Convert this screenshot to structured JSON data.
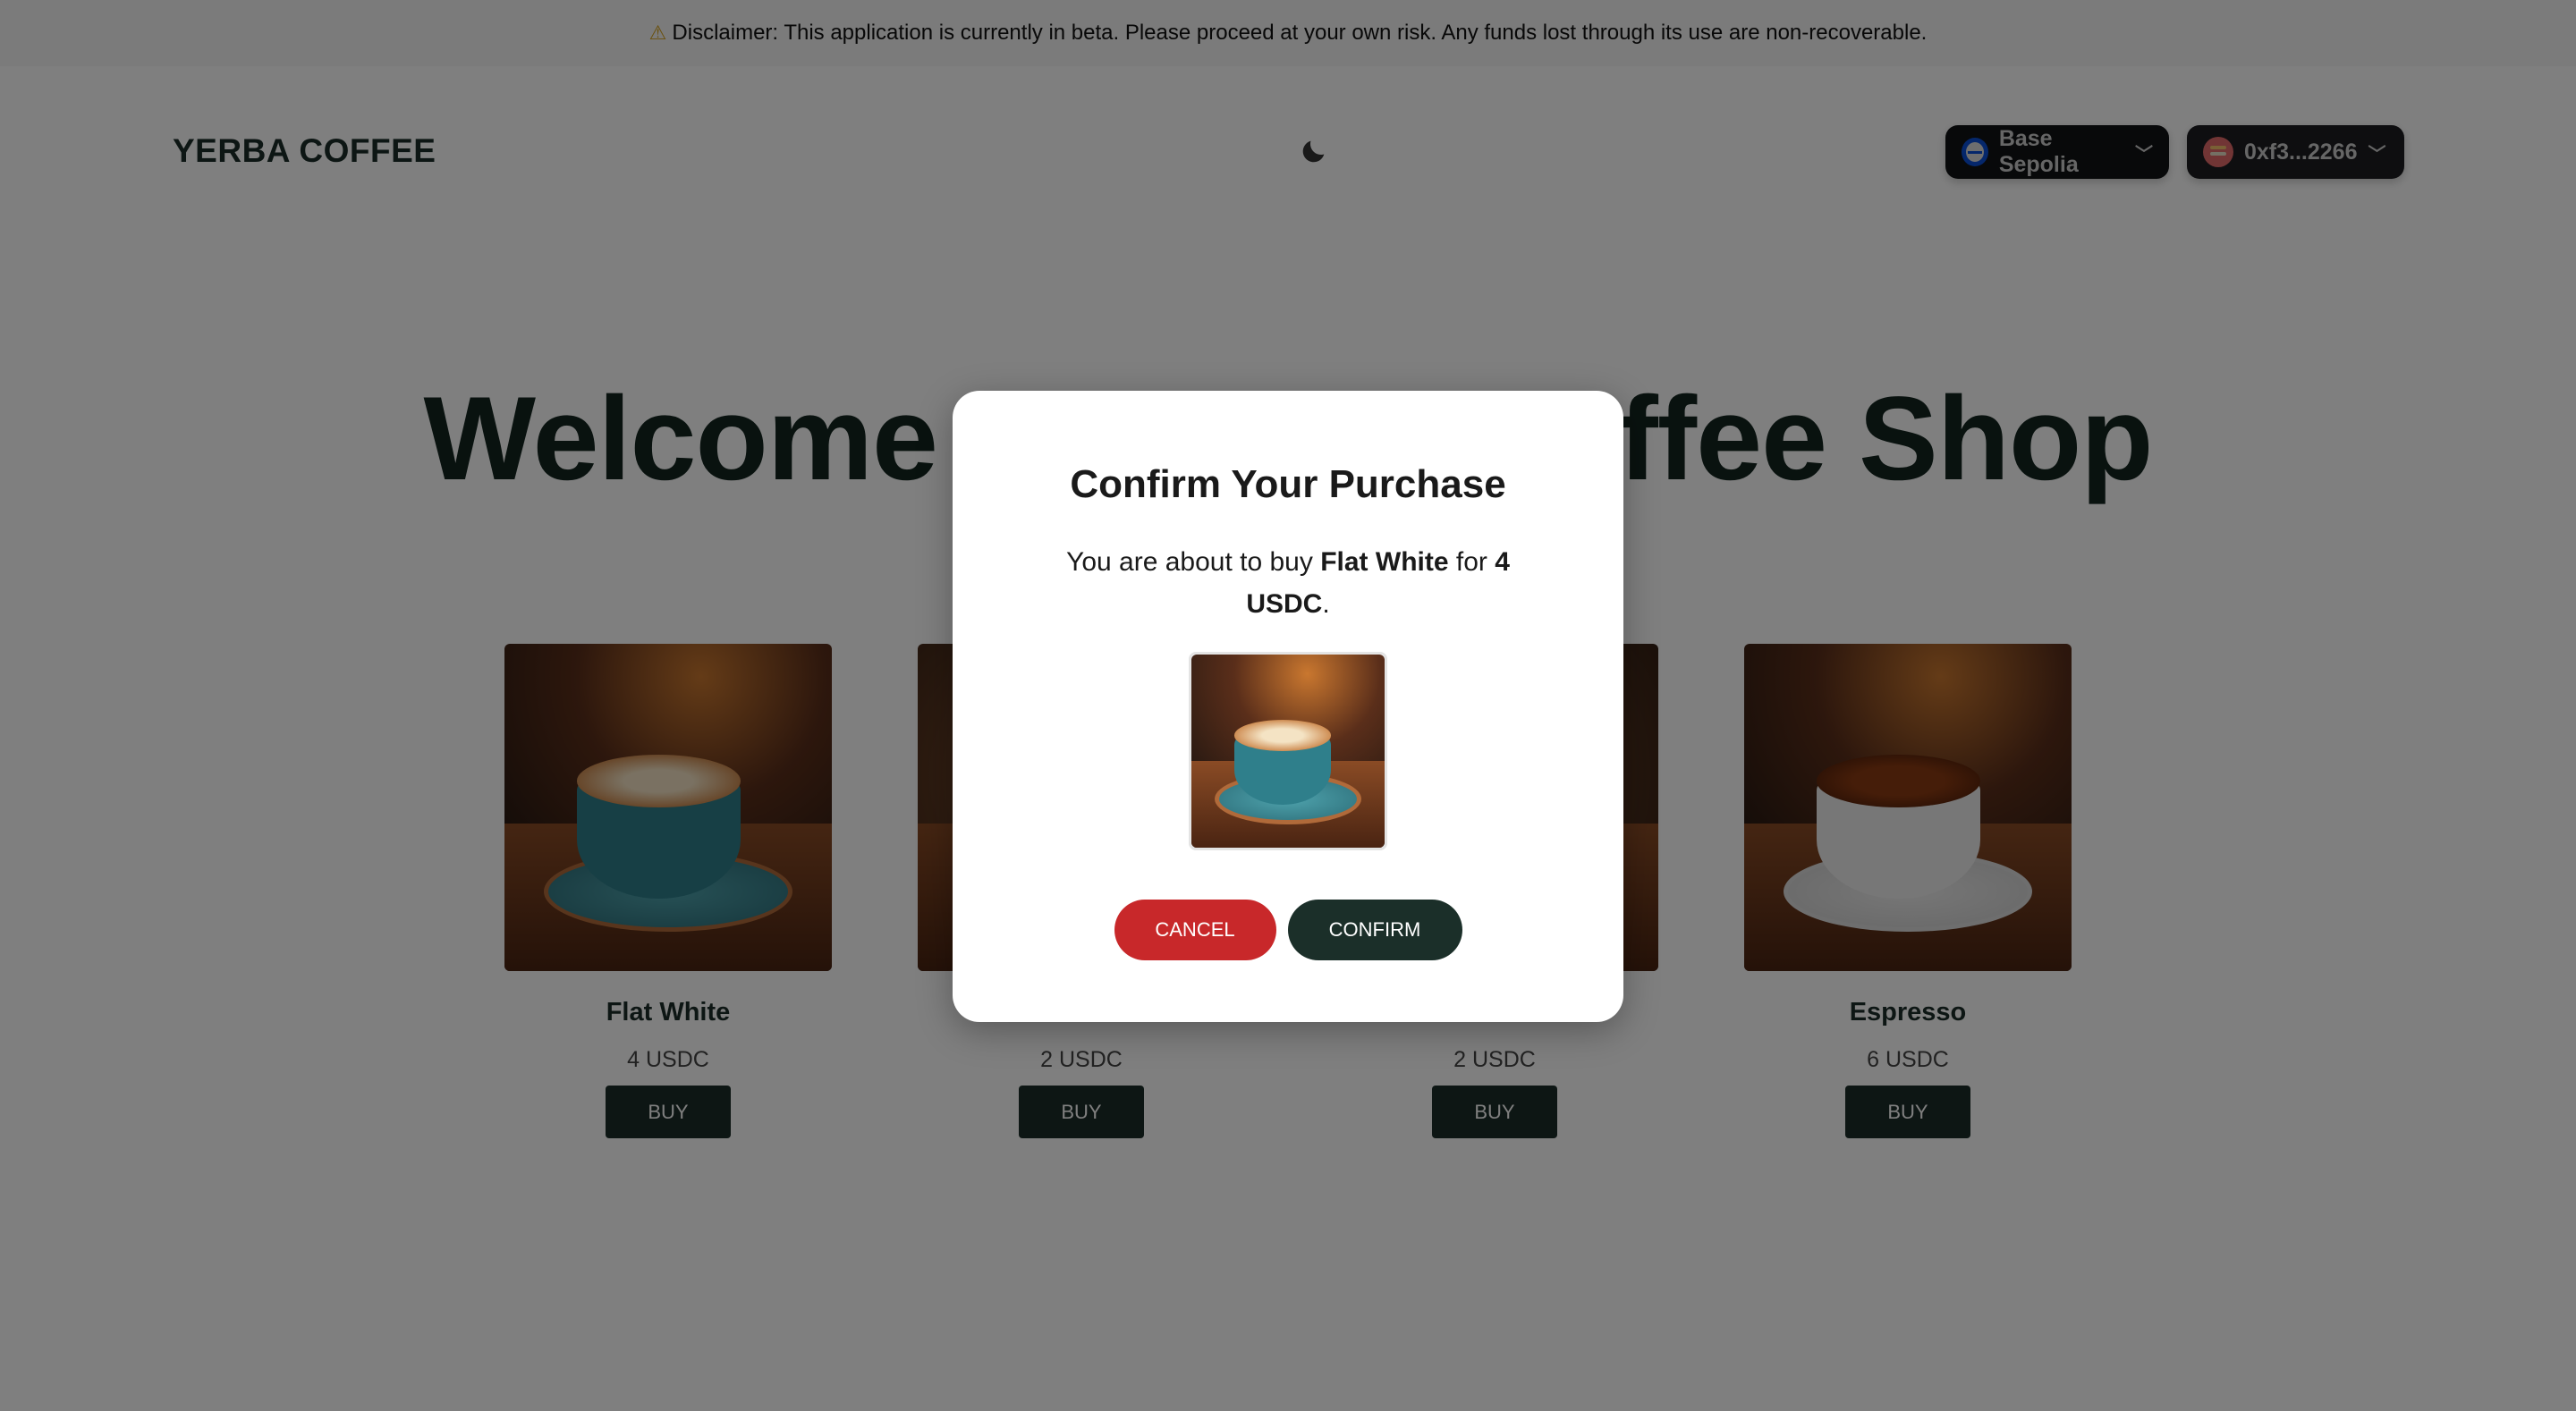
{
  "disclaimer": {
    "icon": "warning-icon",
    "text": "Disclaimer: This application is currently in beta. Please proceed at your own risk. Any funds lost through its use are non-recoverable."
  },
  "header": {
    "logo": "YERBA COFFEE",
    "theme_icon": "moon-icon",
    "network": {
      "label": "Base Sepolia",
      "icon": "base-chain-icon"
    },
    "wallet": {
      "label": "0xf3...2266",
      "icon": "wallet-avatar"
    }
  },
  "hero": {
    "title": "Welcome to Yerba Coffee Shop"
  },
  "products": [
    {
      "name": "Flat White",
      "price": "4 USDC",
      "buy_label": "BUY"
    },
    {
      "name": "",
      "price": "2 USDC",
      "buy_label": "BUY"
    },
    {
      "name": "",
      "price": "2 USDC",
      "buy_label": "BUY"
    },
    {
      "name": "Espresso",
      "price": "6 USDC",
      "buy_label": "BUY"
    }
  ],
  "modal": {
    "title": "Confirm Your Purchase",
    "body_prefix": "You are about to buy ",
    "product": "Flat White",
    "body_mid": " for ",
    "amount": "4 USDC",
    "body_suffix": ".",
    "cancel_label": "CANCEL",
    "confirm_label": "CONFIRM"
  },
  "colors": {
    "primary": "#1b2d28",
    "cancel": "#c8282a",
    "overlay": "rgba(0,0,0,0.5)"
  }
}
